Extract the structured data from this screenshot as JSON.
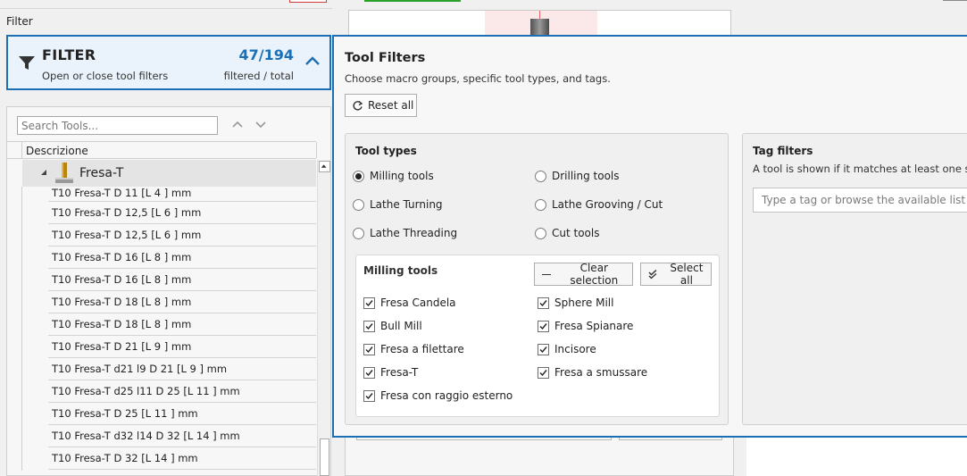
{
  "filter_section_title": "Filter",
  "filter_card": {
    "title": "FILTER",
    "subtitle": "Open or close tool filters",
    "count": "47/194",
    "count_label": "filtered / total"
  },
  "tools_panel": {
    "search_placeholder": "Search Tools...",
    "column_header": "Descrizione",
    "group_label": "Fresa-T",
    "rows": [
      "T10 Fresa-T D 11 [L 4 ] mm",
      "T10 Fresa-T D 12,5 [L 6 ] mm",
      "T10 Fresa-T D 12,5 [L 6 ] mm",
      "T10 Fresa-T D 16 [L 8 ] mm",
      "T10 Fresa-T D 16 [L 8 ] mm",
      "T10 Fresa-T D 18 [L 8 ] mm",
      "T10 Fresa-T D 18 [L 8 ] mm",
      "T10 Fresa-T D 21 [L 9 ] mm",
      "T10 Fresa-T d21 l9 D 21 [L 9 ] mm",
      "T10 Fresa-T d25 l11 D 25 [L 11 ] mm",
      "T10 Fresa-T D 25 [L 11 ] mm",
      "T10 Fresa-T d32 l14 D 32 [L 14 ] mm",
      "T10 Fresa-T D 32 [L 14 ] mm"
    ]
  },
  "popup": {
    "title": "Tool Filters",
    "subtitle": "Choose macro groups, specific tool types, and tags.",
    "reset_label": "Reset all",
    "tool_types": {
      "title": "Tool types",
      "options": [
        {
          "label": "Milling tools",
          "selected": true
        },
        {
          "label": "Drilling tools",
          "selected": false
        },
        {
          "label": "Lathe Turning",
          "selected": false
        },
        {
          "label": "Lathe Grooving / Cut",
          "selected": false
        },
        {
          "label": "Lathe Threading",
          "selected": false
        },
        {
          "label": "Cut tools",
          "selected": false
        }
      ]
    },
    "milling": {
      "title": "Milling tools",
      "clear_label": "Clear selection",
      "select_all_label": "Select all",
      "items": [
        {
          "label": "Fresa Candela",
          "checked": true
        },
        {
          "label": "Sphere Mill",
          "checked": true
        },
        {
          "label": "Bull Mill",
          "checked": true
        },
        {
          "label": "Fresa Spianare",
          "checked": true
        },
        {
          "label": "Fresa a filettare",
          "checked": true
        },
        {
          "label": "Incisore",
          "checked": true
        },
        {
          "label": "Fresa-T",
          "checked": true
        },
        {
          "label": "Fresa a smussare",
          "checked": true
        },
        {
          "label": "Fresa con raggio esterno",
          "checked": true
        }
      ]
    },
    "tags": {
      "title": "Tag filters",
      "description": "A tool is shown if it matches at least one selec",
      "input_placeholder": "Type a tag or browse the available list"
    }
  },
  "colors": {
    "accent": "#1b6fb5",
    "panel_bg": "#f0f0f0",
    "popup_bg": "#f7f7f7"
  }
}
